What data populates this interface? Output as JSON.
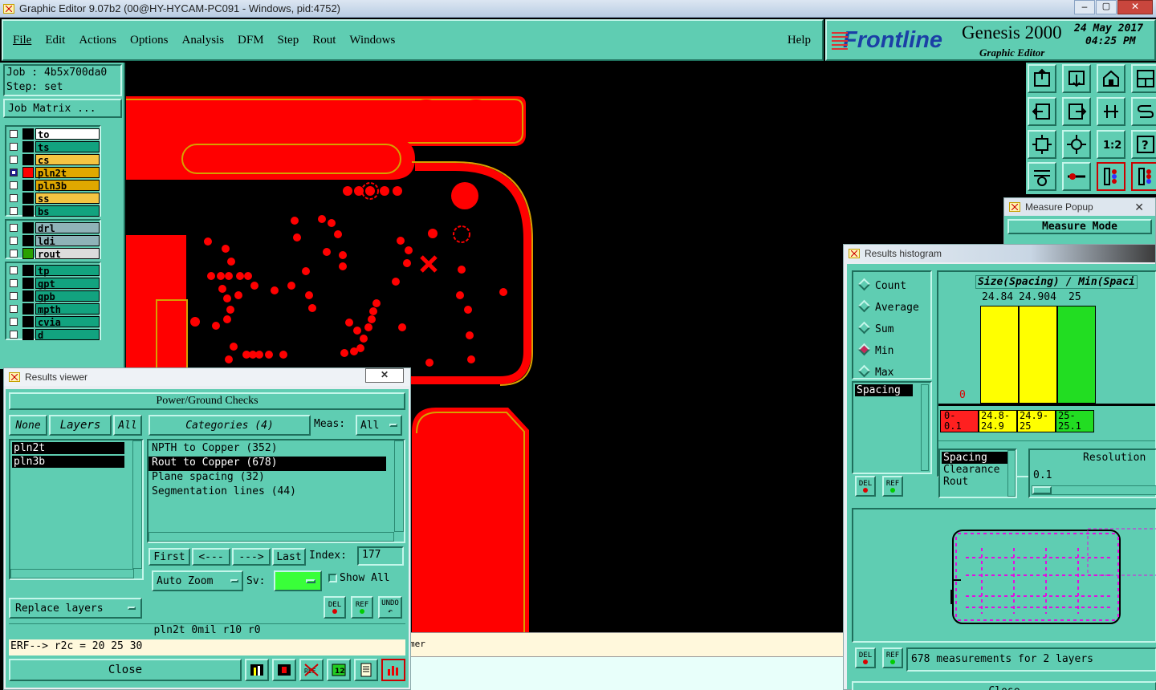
{
  "window_title": "Graphic Editor 9.07b2 (00@HY-HYCAM-PC091 - Windows, pid:4752)",
  "menu": [
    "File",
    "Edit",
    "Actions",
    "Options",
    "Analysis",
    "DFM",
    "Step",
    "Rout",
    "Windows"
  ],
  "help": "Help",
  "brand": {
    "logo": "Frontline",
    "product": "Genesis 2000",
    "subtitle": "Graphic Editor",
    "date": "24 May 2017",
    "time": "04:25 PM"
  },
  "job": {
    "job_line": "Job : 4b5x700da0",
    "step_line": "Step: set",
    "matrix_button": "Job Matrix ..."
  },
  "layers_group1": [
    {
      "name": "to",
      "color": "#ffffff",
      "sw": "#000000"
    },
    {
      "name": "ts",
      "color": "#12a37f",
      "sw": "#000000"
    },
    {
      "name": "cs",
      "color": "#f5c542",
      "sw": "#000000"
    },
    {
      "name": "pln2t",
      "color": "#e0a800",
      "sw": "#ff0000",
      "sel": true
    },
    {
      "name": "pln3b",
      "color": "#e0a800",
      "sw": "#000000"
    },
    {
      "name": "ss",
      "color": "#f5c542",
      "sw": "#000000"
    },
    {
      "name": "bs",
      "color": "#12a37f",
      "sw": "#000000"
    }
  ],
  "layers_group2": [
    {
      "name": "drl",
      "color": "#8fb3b8",
      "sw": "#000000"
    },
    {
      "name": "ldi",
      "color": "#8fb3b8",
      "sw": "#000000"
    },
    {
      "name": "rout",
      "color": "#dcdcdc",
      "sw": "#2aa000"
    }
  ],
  "layers_group3": [
    {
      "name": "tp",
      "color": "#12a37f",
      "sw": "#000000"
    },
    {
      "name": "gpt",
      "color": "#12a37f",
      "sw": "#000000"
    },
    {
      "name": "gpb",
      "color": "#12a37f",
      "sw": "#000000"
    },
    {
      "name": "mpth",
      "color": "#12a37f",
      "sw": "#000000"
    },
    {
      "name": "cvia",
      "color": "#12a37f",
      "sw": "#000000"
    },
    {
      "name": "d",
      "color": "#12a37f",
      "sw": "#000000"
    }
  ],
  "results_viewer": {
    "title": "Results viewer",
    "header": "Power/Ground Checks",
    "none": "None",
    "layers": "Layers",
    "all": "All",
    "categories_label": "Categories (4)",
    "meas_label": "Meas:",
    "meas_value": "All",
    "layer_list": [
      "pln2t",
      "pln3b"
    ],
    "categories": [
      "NPTH to Copper (352)",
      "Rout to Copper (678)",
      "Plane spacing (32)",
      "Segmentation lines (44)"
    ],
    "first": "First",
    "prev": "<---",
    "next": "--->",
    "last": "Last",
    "index_label": "Index:",
    "index_value": "177",
    "auto_zoom": "Auto Zoom",
    "sv_label": "Sv:",
    "show_all": "Show All",
    "replace_layers": "Replace layers",
    "del": "DEL",
    "ref": "REF",
    "undo": "UNDO",
    "status": "pln2t 0mil   r10   r0",
    "erf": "ERF--> r2c = 20 25 30",
    "close": "Close"
  },
  "measure_popup": {
    "title": "Measure Popup",
    "mode": "Measure Mode"
  },
  "histogram": {
    "title": "Results histogram",
    "options": [
      "Count",
      "Average",
      "Sum",
      "Min",
      "Max"
    ],
    "selected_option": "Min",
    "measure_list": [
      "Spacing"
    ],
    "chart_title": "Size(Spacing) / Min(Spaci",
    "top_labels": [
      "24.84",
      "24.904",
      "25"
    ],
    "zero_label": "0",
    "bins": [
      {
        "label": "0-\n0.1",
        "color": "#ff2020",
        "count": 0
      },
      {
        "label": "24.8-\n24.9",
        "color": "#ffff00",
        "value": 24.84
      },
      {
        "label": "24.9-\n25",
        "color": "#ffff00",
        "value": 24.904
      },
      {
        "label": "25-\n25.1",
        "color": "#22dd22",
        "value": 25
      }
    ],
    "type_list": [
      "Spacing",
      "Clearance",
      "Rout"
    ],
    "resolution_label": "Resolution",
    "resolution_value": "0.1",
    "summary": "678 measurements for 2 layers",
    "close": "Close"
  },
  "bottom_partial": "mer"
}
